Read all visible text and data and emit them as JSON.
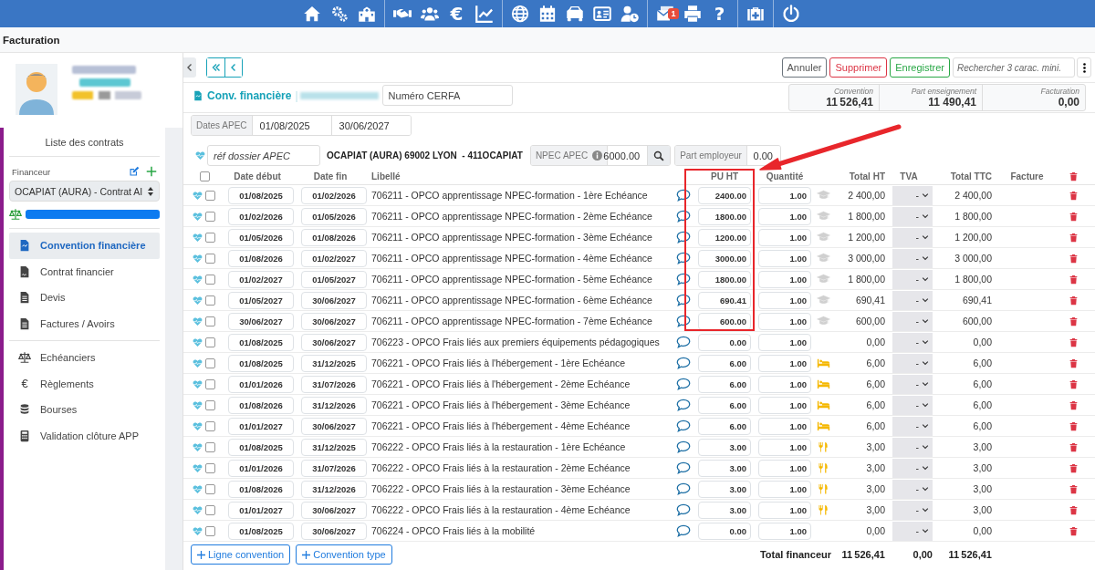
{
  "top_bar": {
    "groups": [
      {
        "items": [
          {
            "kind": "icon"
          },
          {
            "kind": "icon"
          },
          {
            "kind": "icon"
          }
        ]
      },
      {
        "items": [
          {
            "kind": "icon"
          },
          {
            "kind": "icon"
          },
          {
            "kind": "glyph",
            "glyph": "€"
          },
          {
            "kind": "icon"
          }
        ]
      },
      {
        "items": [
          {
            "kind": "icon"
          },
          {
            "kind": "icon"
          },
          {
            "kind": "icon"
          },
          {
            "kind": "icon"
          },
          {
            "kind": "icon"
          }
        ]
      },
      {
        "items": [
          {
            "kind": "icon",
            "badge": "1"
          },
          {
            "kind": "icon"
          },
          {
            "kind": "glyph",
            "glyph": "?"
          }
        ]
      },
      {
        "items": [
          {
            "kind": "icon"
          }
        ]
      },
      {
        "items": [
          {
            "kind": "icon"
          }
        ]
      }
    ]
  },
  "page_title": "Facturation",
  "sidebar": {
    "list_title": "Liste des contrats",
    "financeur_label": "Financeur",
    "contract_select": "OCAPIAT (AURA) - Contrat AI",
    "nav_groups": [
      {
        "items": [
          {
            "label": "Convention financière",
            "selected": true
          },
          {
            "label": "Contrat financier",
            "selected": false
          },
          {
            "label": "Devis",
            "selected": false
          },
          {
            "label": "Factures / Avoirs",
            "selected": false
          }
        ]
      },
      {
        "items": [
          {
            "label": "Echéanciers",
            "selected": false
          },
          {
            "label": "Règlements",
            "glyph": "€",
            "selected": false
          },
          {
            "label": "Bourses",
            "selected": false
          },
          {
            "label": "Validation clôture APP",
            "selected": false
          }
        ]
      }
    ]
  },
  "toolbar": {
    "buttons": [
      {
        "label": "Annuler",
        "kind": "secondary"
      },
      {
        "label": "Supprimer",
        "kind": "danger"
      },
      {
        "label": "Enregistrer",
        "kind": "success"
      }
    ],
    "search_placeholder": "Rechercher 3 carac. mini."
  },
  "document": {
    "title": "Conv. financière",
    "separator": "|",
    "cerfa_placeholder": "Numéro CERFA"
  },
  "summary": [
    {
      "label": "Convention",
      "value": "11 526,41"
    },
    {
      "label": "Part enseignement",
      "value": "11 490,41"
    },
    {
      "label": "Facturation",
      "value": "0,00"
    }
  ],
  "dates_apec": {
    "label": "Dates APEC",
    "start": "01/08/2025",
    "end": "30/06/2027"
  },
  "apec": {
    "ref_placeholder": "réf dossier APEC",
    "financeur": "OCAPIAT (AURA) 69002 LYON  - 411OCAPIAT",
    "npec_label": "NPEC APEC",
    "npec_value": "6000.00",
    "employer_label": "Part employeur",
    "employer_value": "0.00"
  },
  "table": {
    "all_checked": false,
    "columns": [
      "Date début",
      "Date fin",
      "Libellé",
      "PU HT",
      "Quantité",
      "Total HT",
      "TVA",
      "Total TTC",
      "Facture"
    ],
    "rows": [
      {
        "checked": false,
        "start": "01/08/2025",
        "end": "01/02/2026",
        "label": "706211 - OPCO apprentissage NPEC-formation - 1ère Echéance",
        "pu": "2400.00",
        "qty": "1.00",
        "kind": "formation",
        "total_ht": "2 400,00",
        "tva": "-",
        "total_ttc": "2 400,00"
      },
      {
        "checked": false,
        "start": "01/02/2026",
        "end": "01/05/2026",
        "label": "706211 - OPCO apprentissage NPEC-formation - 2ème Echéance",
        "pu": "1800.00",
        "qty": "1.00",
        "kind": "formation",
        "total_ht": "1 800,00",
        "tva": "-",
        "total_ttc": "1 800,00"
      },
      {
        "checked": false,
        "start": "01/05/2026",
        "end": "01/08/2026",
        "label": "706211 - OPCO apprentissage NPEC-formation - 3ème Echéance",
        "pu": "1200.00",
        "qty": "1.00",
        "kind": "formation",
        "total_ht": "1 200,00",
        "tva": "-",
        "total_ttc": "1 200,00"
      },
      {
        "checked": false,
        "start": "01/08/2026",
        "end": "01/02/2027",
        "label": "706211 - OPCO apprentissage NPEC-formation - 4ème Echéance",
        "pu": "3000.00",
        "qty": "1.00",
        "kind": "formation",
        "total_ht": "3 000,00",
        "tva": "-",
        "total_ttc": "3 000,00"
      },
      {
        "checked": false,
        "start": "01/02/2027",
        "end": "01/05/2027",
        "label": "706211 - OPCO apprentissage NPEC-formation - 5ème Echéance",
        "pu": "1800.00",
        "qty": "1.00",
        "kind": "formation",
        "total_ht": "1 800,00",
        "tva": "-",
        "total_ttc": "1 800,00"
      },
      {
        "checked": false,
        "start": "01/05/2027",
        "end": "30/06/2027",
        "label": "706211 - OPCO apprentissage NPEC-formation - 6ème Echéance",
        "pu": "690.41",
        "qty": "1.00",
        "kind": "formation",
        "total_ht": "690,41",
        "tva": "-",
        "total_ttc": "690,41"
      },
      {
        "checked": false,
        "start": "30/06/2027",
        "end": "30/06/2027",
        "label": "706211 - OPCO apprentissage NPEC-formation - 7ème Echéance",
        "pu": "600.00",
        "qty": "1.00",
        "kind": "formation",
        "total_ht": "600,00",
        "tva": "-",
        "total_ttc": "600,00"
      },
      {
        "checked": false,
        "start": "01/08/2025",
        "end": "30/06/2027",
        "label": "706223 - OPCO Frais liés aux premiers équipements pédagogiques",
        "pu": "0.00",
        "qty": "1.00",
        "kind": "plain",
        "total_ht": "0,00",
        "tva": "-",
        "total_ttc": "0,00"
      },
      {
        "checked": false,
        "start": "01/08/2025",
        "end": "31/12/2025",
        "label": "706221 - OPCO Frais liés à l'hébergement - 1ère Echéance",
        "pu": "6.00",
        "qty": "1.00",
        "kind": "lodging",
        "total_ht": "6,00",
        "tva": "-",
        "total_ttc": "6,00"
      },
      {
        "checked": false,
        "start": "01/01/2026",
        "end": "31/07/2026",
        "label": "706221 - OPCO Frais liés à l'hébergement - 2ème Echéance",
        "pu": "6.00",
        "qty": "1.00",
        "kind": "lodging",
        "total_ht": "6,00",
        "tva": "-",
        "total_ttc": "6,00"
      },
      {
        "checked": false,
        "start": "01/08/2026",
        "end": "31/12/2026",
        "label": "706221 - OPCO Frais liés à l'hébergement - 3ème Echéance",
        "pu": "6.00",
        "qty": "1.00",
        "kind": "lodging",
        "total_ht": "6,00",
        "tva": "-",
        "total_ttc": "6,00"
      },
      {
        "checked": false,
        "start": "01/01/2027",
        "end": "30/06/2027",
        "label": "706221 - OPCO Frais liés à l'hébergement - 4ème Echéance",
        "pu": "6.00",
        "qty": "1.00",
        "kind": "lodging",
        "total_ht": "6,00",
        "tva": "-",
        "total_ttc": "6,00"
      },
      {
        "checked": false,
        "start": "01/08/2025",
        "end": "31/12/2025",
        "label": "706222 - OPCO Frais liés à la restauration - 1ère Echéance",
        "pu": "3.00",
        "qty": "1.00",
        "kind": "meal",
        "total_ht": "3,00",
        "tva": "-",
        "total_ttc": "3,00"
      },
      {
        "checked": false,
        "start": "01/01/2026",
        "end": "31/07/2026",
        "label": "706222 - OPCO Frais liés à la restauration - 2ème Echéance",
        "pu": "3.00",
        "qty": "1.00",
        "kind": "meal",
        "total_ht": "3,00",
        "tva": "-",
        "total_ttc": "3,00"
      },
      {
        "checked": false,
        "start": "01/08/2026",
        "end": "31/12/2026",
        "label": "706222 - OPCO Frais liés à la restauration - 3ème Echéance",
        "pu": "3.00",
        "qty": "1.00",
        "kind": "meal",
        "total_ht": "3,00",
        "tva": "-",
        "total_ttc": "3,00"
      },
      {
        "checked": false,
        "start": "01/01/2027",
        "end": "30/06/2027",
        "label": "706222 - OPCO Frais liés à la restauration - 4ème Echéance",
        "pu": "3.00",
        "qty": "1.00",
        "kind": "meal",
        "total_ht": "3,00",
        "tva": "-",
        "total_ttc": "3,00"
      },
      {
        "checked": false,
        "start": "01/08/2025",
        "end": "30/06/2027",
        "label": "706224 - OPCO Frais liés à la mobilité",
        "pu": "0.00",
        "qty": "1.00",
        "kind": "plain",
        "total_ht": "0,00",
        "tva": "-",
        "total_ttc": "0,00"
      }
    ]
  },
  "totals": {
    "label": "Total financeur",
    "total_ht": "11 526,41",
    "tva": "0,00",
    "total_ttc": "11 526,41"
  },
  "footer_buttons": [
    {
      "label": "Ligne convention"
    },
    {
      "label": "Convention type"
    }
  ],
  "annotation": {
    "kind": "callout"
  }
}
